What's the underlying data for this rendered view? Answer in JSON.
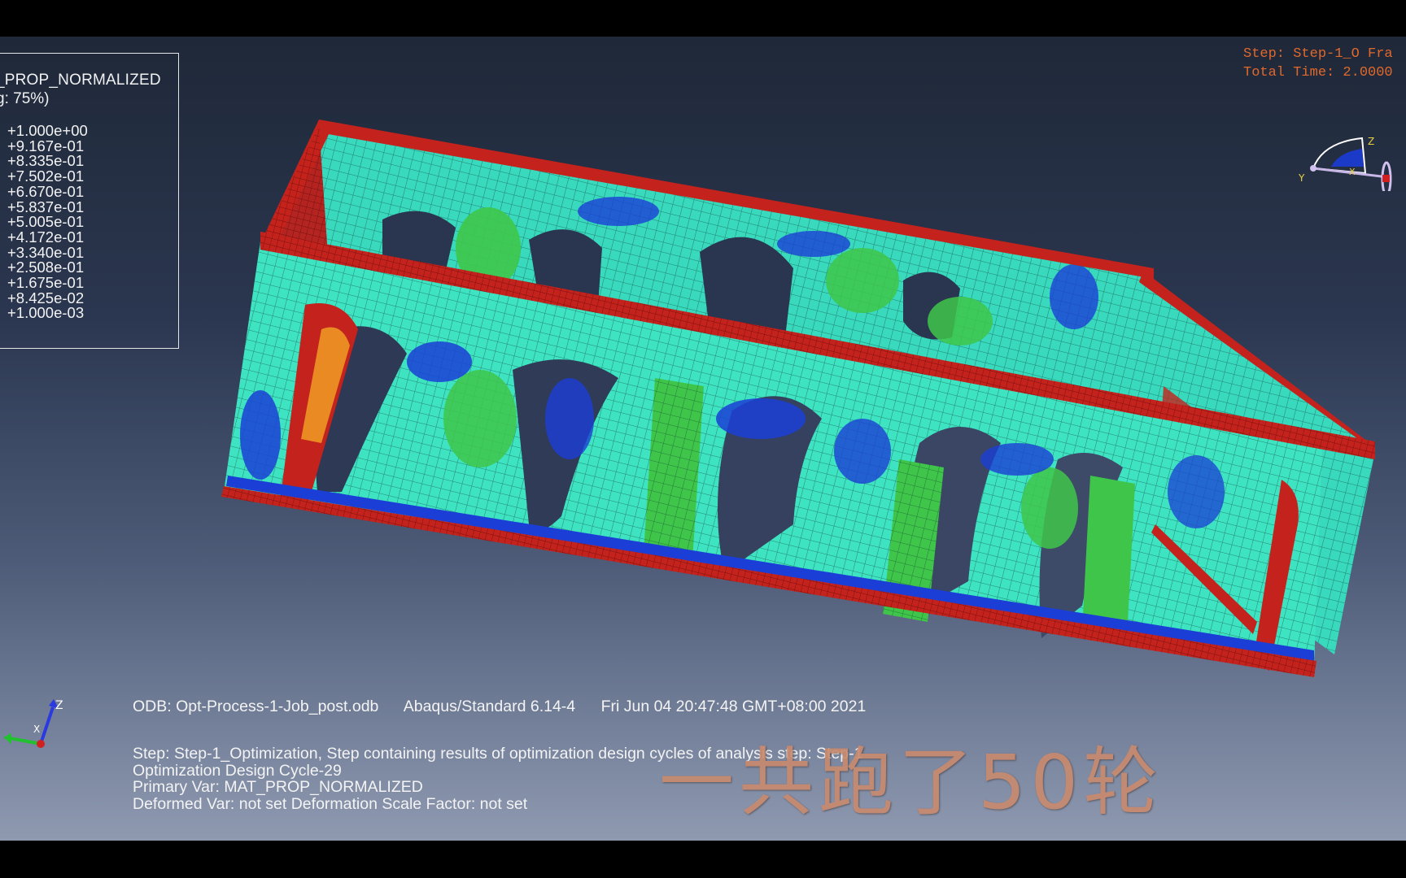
{
  "legend": {
    "title": "_PROP_NORMALIZED",
    "subtitle": "g: 75%)",
    "values": [
      "+1.000e+00",
      "+9.167e-01",
      "+8.335e-01",
      "+7.502e-01",
      "+6.670e-01",
      "+5.837e-01",
      "+5.005e-01",
      "+4.172e-01",
      "+3.340e-01",
      "+2.508e-01",
      "+1.675e-01",
      "+8.425e-02",
      "+1.000e-03"
    ]
  },
  "step_info": {
    "line1": "Step: Step-1_O Fra",
    "line2": "Total Time: 2.0000"
  },
  "triad_top": {
    "z": "Z",
    "y": "Y",
    "x": "X"
  },
  "triad_bottom": {
    "z": "Z",
    "x": "X"
  },
  "status": {
    "odb": "ODB: Opt-Process-1-Job_post.odb",
    "version": "Abaqus/Standard 6.14-4",
    "date": "Fri Jun 04 20:47:48 GMT+08:00 2021",
    "step": "Step: Step-1_Optimization, Step containing results of optimization design cycles of analysis step: Step-1",
    "cycle": "Optimization Design Cycle-29",
    "primary_var": "Primary Var: MAT_PROP_NORMALIZED",
    "deformed_var": "Deformed Var: not set   Deformation Scale Factor: not set"
  },
  "caption": "一共跑了50轮",
  "colors": {
    "frame_red": "#c4221c",
    "cyan": "#40e0c0",
    "green": "#3fc64a",
    "blue": "#1b3fd6",
    "orange": "#e0682c"
  },
  "icons": [
    "triad-axis-icon"
  ]
}
